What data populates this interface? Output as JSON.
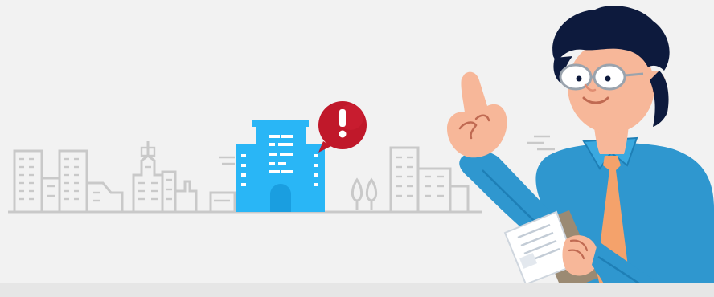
{
  "banner": {
    "background_color": "#f2f2f2",
    "skyline_color": "#c9c9c9",
    "highlighted_building_color": "#29b6f6",
    "alert_badge_color": "#c0182a",
    "alert_symbol": "!",
    "character": {
      "shirt_color": "#2f97cf",
      "tie_color": "#f4a26b",
      "hair_color": "#0d1a3d",
      "skin_color": "#f7b799",
      "clipboard_color": "#9b8a73"
    }
  }
}
